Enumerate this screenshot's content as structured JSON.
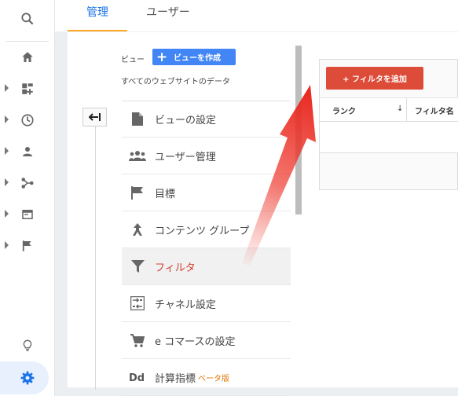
{
  "tabs": [
    {
      "label": "管理",
      "active": true
    },
    {
      "label": "ユーザー",
      "active": false
    }
  ],
  "rail": {
    "icons": [
      "search-icon",
      "home-icon",
      "customization-icon",
      "realtime-clock-icon",
      "audience-person-icon",
      "acquisition-icon",
      "behavior-icon",
      "conversions-flag-icon",
      "discover-lightbulb-icon",
      "admin-gear-icon"
    ]
  },
  "view": {
    "label": "ビュー",
    "create_button": "ビューを作成",
    "create_icon": "plus-icon",
    "selected": "すべてのウェブサイトのデータ"
  },
  "menu": [
    {
      "label": "ビューの設定",
      "icon": "document-icon",
      "active": false
    },
    {
      "label": "ユーザー管理",
      "icon": "people-icon",
      "active": false
    },
    {
      "label": "目標",
      "icon": "flag-icon",
      "active": false
    },
    {
      "label": "コンテンツ グループ",
      "icon": "merge-arrow-icon",
      "active": false
    },
    {
      "label": "フィルタ",
      "icon": "funnel-icon",
      "active": true
    },
    {
      "label": "チャネル設定",
      "icon": "channel-settings-icon",
      "active": false
    },
    {
      "label": "e コマースの設定",
      "icon": "cart-icon",
      "active": false
    },
    {
      "label": "計算指標",
      "icon": "dd-icon",
      "active": false,
      "badge": "ベータ版"
    }
  ],
  "filters": {
    "add_button": "+ フィルタを追加",
    "columns": [
      "ランク",
      "フィルタ名"
    ],
    "sort_icon": "sort-down-arrow-icon"
  },
  "colors": {
    "accent_blue": "#1a73e8",
    "active_tab_underline": "#ffa726",
    "create_button": "#4285f4",
    "add_filter_button": "#dd4b39",
    "active_menu_text": "#d23f31",
    "annotation_arrow": "#e8261e"
  }
}
